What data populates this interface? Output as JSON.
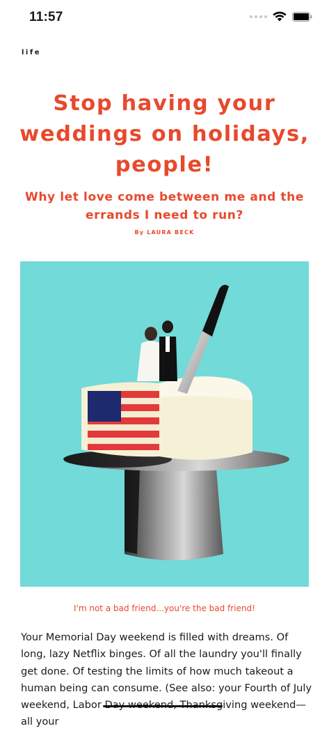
{
  "status_bar": {
    "time": "11:57"
  },
  "article": {
    "section": "life",
    "headline": "Stop having your weddings on holidays, people!",
    "subheadline": "Why let love come between me and the errands I need to run?",
    "byline": "By LAURA BECK",
    "image_caption": "I'm not a bad friend...you're the bad friend!",
    "body": "Your Memorial Day weekend is filled with dreams. Of long, lazy Netflix binges. Of all the laundry you'll finally get done. Of testing the limits of how much takeout a human being can consume. (See also: your Fourth of July weekend, Labor Day weekend, Thanksgiving weekend—all your"
  },
  "colors": {
    "accent": "#e8492c",
    "hero_background": "#72dad8",
    "text": "#1a1a1a"
  },
  "icons": {
    "signal": "cellular-signal-icon",
    "wifi": "wifi-icon",
    "battery": "battery-icon"
  }
}
